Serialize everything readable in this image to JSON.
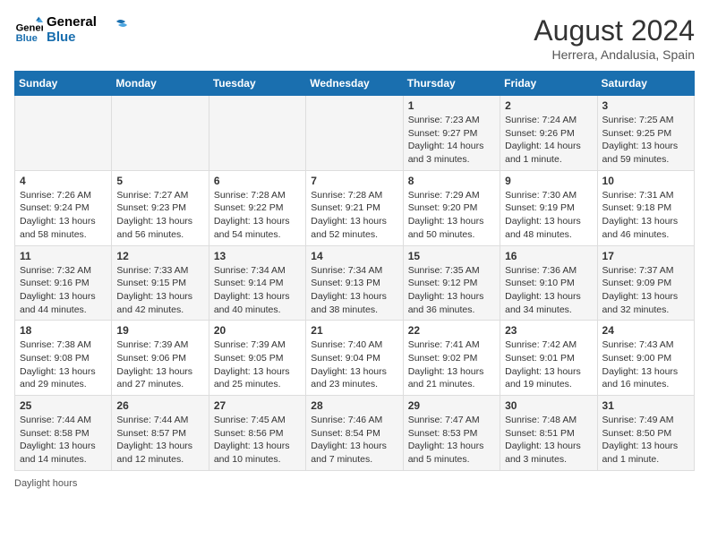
{
  "logo": {
    "line1": "General",
    "line2": "Blue"
  },
  "title": "August 2024",
  "subtitle": "Herrera, Andalusia, Spain",
  "weekdays": [
    "Sunday",
    "Monday",
    "Tuesday",
    "Wednesday",
    "Thursday",
    "Friday",
    "Saturday"
  ],
  "weeks": [
    [
      {
        "day": "",
        "info": ""
      },
      {
        "day": "",
        "info": ""
      },
      {
        "day": "",
        "info": ""
      },
      {
        "day": "",
        "info": ""
      },
      {
        "day": "1",
        "info": "Sunrise: 7:23 AM\nSunset: 9:27 PM\nDaylight: 14 hours\nand 3 minutes."
      },
      {
        "day": "2",
        "info": "Sunrise: 7:24 AM\nSunset: 9:26 PM\nDaylight: 14 hours\nand 1 minute."
      },
      {
        "day": "3",
        "info": "Sunrise: 7:25 AM\nSunset: 9:25 PM\nDaylight: 13 hours\nand 59 minutes."
      }
    ],
    [
      {
        "day": "4",
        "info": "Sunrise: 7:26 AM\nSunset: 9:24 PM\nDaylight: 13 hours\nand 58 minutes."
      },
      {
        "day": "5",
        "info": "Sunrise: 7:27 AM\nSunset: 9:23 PM\nDaylight: 13 hours\nand 56 minutes."
      },
      {
        "day": "6",
        "info": "Sunrise: 7:28 AM\nSunset: 9:22 PM\nDaylight: 13 hours\nand 54 minutes."
      },
      {
        "day": "7",
        "info": "Sunrise: 7:28 AM\nSunset: 9:21 PM\nDaylight: 13 hours\nand 52 minutes."
      },
      {
        "day": "8",
        "info": "Sunrise: 7:29 AM\nSunset: 9:20 PM\nDaylight: 13 hours\nand 50 minutes."
      },
      {
        "day": "9",
        "info": "Sunrise: 7:30 AM\nSunset: 9:19 PM\nDaylight: 13 hours\nand 48 minutes."
      },
      {
        "day": "10",
        "info": "Sunrise: 7:31 AM\nSunset: 9:18 PM\nDaylight: 13 hours\nand 46 minutes."
      }
    ],
    [
      {
        "day": "11",
        "info": "Sunrise: 7:32 AM\nSunset: 9:16 PM\nDaylight: 13 hours\nand 44 minutes."
      },
      {
        "day": "12",
        "info": "Sunrise: 7:33 AM\nSunset: 9:15 PM\nDaylight: 13 hours\nand 42 minutes."
      },
      {
        "day": "13",
        "info": "Sunrise: 7:34 AM\nSunset: 9:14 PM\nDaylight: 13 hours\nand 40 minutes."
      },
      {
        "day": "14",
        "info": "Sunrise: 7:34 AM\nSunset: 9:13 PM\nDaylight: 13 hours\nand 38 minutes."
      },
      {
        "day": "15",
        "info": "Sunrise: 7:35 AM\nSunset: 9:12 PM\nDaylight: 13 hours\nand 36 minutes."
      },
      {
        "day": "16",
        "info": "Sunrise: 7:36 AM\nSunset: 9:10 PM\nDaylight: 13 hours\nand 34 minutes."
      },
      {
        "day": "17",
        "info": "Sunrise: 7:37 AM\nSunset: 9:09 PM\nDaylight: 13 hours\nand 32 minutes."
      }
    ],
    [
      {
        "day": "18",
        "info": "Sunrise: 7:38 AM\nSunset: 9:08 PM\nDaylight: 13 hours\nand 29 minutes."
      },
      {
        "day": "19",
        "info": "Sunrise: 7:39 AM\nSunset: 9:06 PM\nDaylight: 13 hours\nand 27 minutes."
      },
      {
        "day": "20",
        "info": "Sunrise: 7:39 AM\nSunset: 9:05 PM\nDaylight: 13 hours\nand 25 minutes."
      },
      {
        "day": "21",
        "info": "Sunrise: 7:40 AM\nSunset: 9:04 PM\nDaylight: 13 hours\nand 23 minutes."
      },
      {
        "day": "22",
        "info": "Sunrise: 7:41 AM\nSunset: 9:02 PM\nDaylight: 13 hours\nand 21 minutes."
      },
      {
        "day": "23",
        "info": "Sunrise: 7:42 AM\nSunset: 9:01 PM\nDaylight: 13 hours\nand 19 minutes."
      },
      {
        "day": "24",
        "info": "Sunrise: 7:43 AM\nSunset: 9:00 PM\nDaylight: 13 hours\nand 16 minutes."
      }
    ],
    [
      {
        "day": "25",
        "info": "Sunrise: 7:44 AM\nSunset: 8:58 PM\nDaylight: 13 hours\nand 14 minutes."
      },
      {
        "day": "26",
        "info": "Sunrise: 7:44 AM\nSunset: 8:57 PM\nDaylight: 13 hours\nand 12 minutes."
      },
      {
        "day": "27",
        "info": "Sunrise: 7:45 AM\nSunset: 8:56 PM\nDaylight: 13 hours\nand 10 minutes."
      },
      {
        "day": "28",
        "info": "Sunrise: 7:46 AM\nSunset: 8:54 PM\nDaylight: 13 hours\nand 7 minutes."
      },
      {
        "day": "29",
        "info": "Sunrise: 7:47 AM\nSunset: 8:53 PM\nDaylight: 13 hours\nand 5 minutes."
      },
      {
        "day": "30",
        "info": "Sunrise: 7:48 AM\nSunset: 8:51 PM\nDaylight: 13 hours\nand 3 minutes."
      },
      {
        "day": "31",
        "info": "Sunrise: 7:49 AM\nSunset: 8:50 PM\nDaylight: 13 hours\nand 1 minute."
      }
    ]
  ],
  "footer": "Daylight hours"
}
